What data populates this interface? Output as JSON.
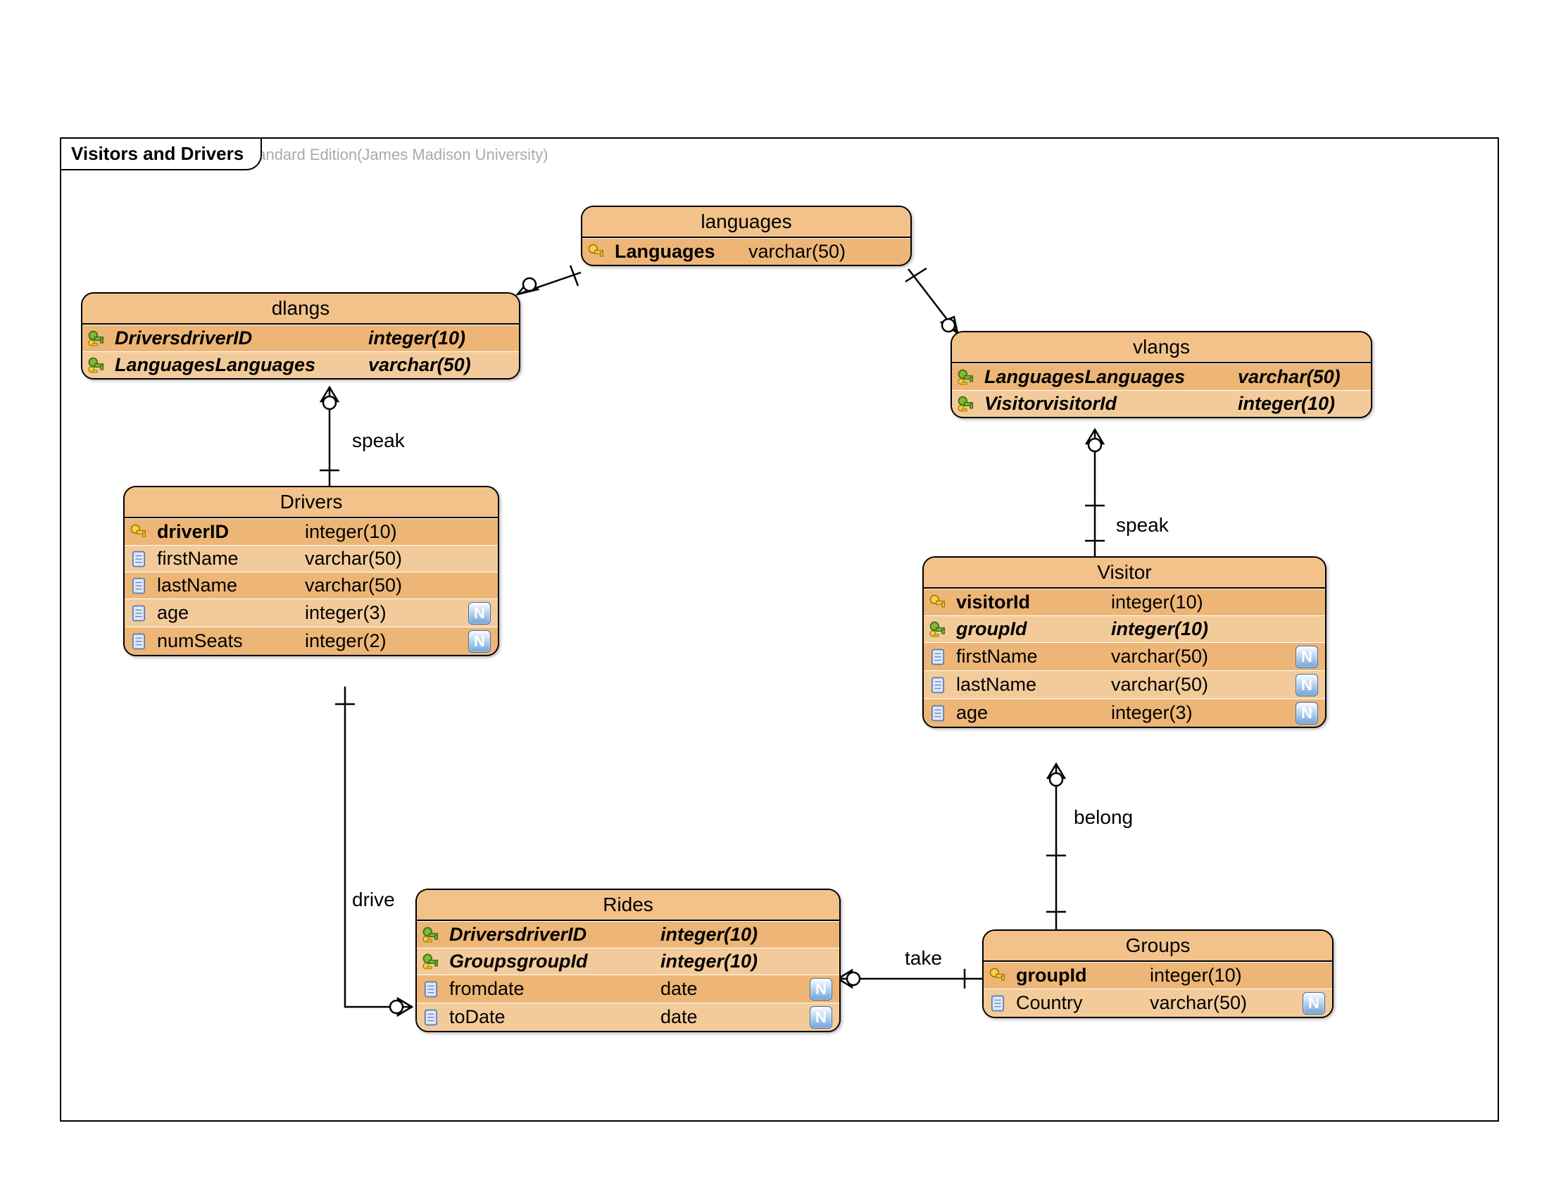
{
  "meta": {
    "watermark": "Visual Paradigm for UML Standard Edition(James Madison University)",
    "frame": "Visitors and Drivers"
  },
  "ent": {
    "languages": {
      "title": "languages",
      "r": [
        {
          "n": "Languages",
          "t": "varchar(50)",
          "nul": false,
          "pk": true
        }
      ]
    },
    "dlangs": {
      "title": "dlangs",
      "r": [
        {
          "n": "DriversdriverID",
          "t": "integer(10)",
          "nul": false,
          "fk": true,
          "ital": true
        },
        {
          "n": "LanguagesLanguages",
          "t": "varchar(50)",
          "nul": false,
          "fk": true,
          "ital": true
        }
      ]
    },
    "vlangs": {
      "title": "vlangs",
      "r": [
        {
          "n": "LanguagesLanguages",
          "t": "varchar(50)",
          "nul": false,
          "fk": true,
          "ital": true
        },
        {
          "n": "VisitorvisitorId",
          "t": "integer(10)",
          "nul": false,
          "fk": true,
          "ital": true
        }
      ]
    },
    "drivers": {
      "title": "Drivers",
      "r": [
        {
          "n": "driverID",
          "t": "integer(10)",
          "nul": false,
          "pk": true
        },
        {
          "n": "firstName",
          "t": "varchar(50)",
          "nul": false
        },
        {
          "n": "lastName",
          "t": "varchar(50)",
          "nul": false
        },
        {
          "n": "age",
          "t": "integer(3)",
          "nul": true
        },
        {
          "n": "numSeats",
          "t": "integer(2)",
          "nul": true
        }
      ]
    },
    "visitor": {
      "title": "Visitor",
      "r": [
        {
          "n": "visitorId",
          "t": "integer(10)",
          "nul": false,
          "pk": true
        },
        {
          "n": "groupId",
          "t": "integer(10)",
          "nul": false,
          "fk": true,
          "ital": true
        },
        {
          "n": "firstName",
          "t": "varchar(50)",
          "nul": true
        },
        {
          "n": "lastName",
          "t": "varchar(50)",
          "nul": true
        },
        {
          "n": "age",
          "t": "integer(3)",
          "nul": true
        }
      ]
    },
    "rides": {
      "title": "Rides",
      "r": [
        {
          "n": "DriversdriverID",
          "t": "integer(10)",
          "nul": false,
          "fk": true,
          "ital": true
        },
        {
          "n": "GroupsgroupId",
          "t": "integer(10)",
          "nul": false,
          "fk": true,
          "ital": true
        },
        {
          "n": "fromdate",
          "t": "date",
          "nul": true
        },
        {
          "n": "toDate",
          "t": "date",
          "nul": true
        }
      ]
    },
    "groups": {
      "title": "Groups",
      "r": [
        {
          "n": "groupId",
          "t": "integer(10)",
          "nul": false,
          "pk": true
        },
        {
          "n": "Country",
          "t": "varchar(50)",
          "nul": true
        }
      ]
    }
  },
  "rel": {
    "speak1": "speak",
    "speak2": "speak",
    "drive": "drive",
    "take": "take",
    "belong": "belong"
  }
}
